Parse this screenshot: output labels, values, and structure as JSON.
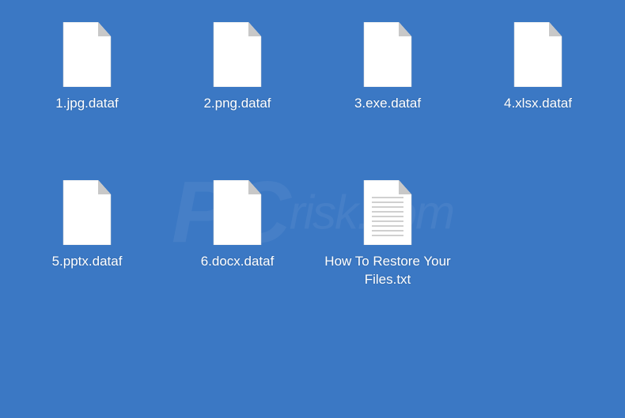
{
  "watermark": {
    "pc": "PC",
    "risk": "risk.com"
  },
  "files": [
    {
      "name": "1.jpg.dataf",
      "type": "blank"
    },
    {
      "name": "2.png.dataf",
      "type": "blank"
    },
    {
      "name": "3.exe.dataf",
      "type": "blank"
    },
    {
      "name": "4.xlsx.dataf",
      "type": "blank"
    },
    {
      "name": "5.pptx.dataf",
      "type": "blank"
    },
    {
      "name": "6.docx.dataf",
      "type": "blank"
    },
    {
      "name": "How To Restore Your Files.txt",
      "type": "text"
    }
  ]
}
